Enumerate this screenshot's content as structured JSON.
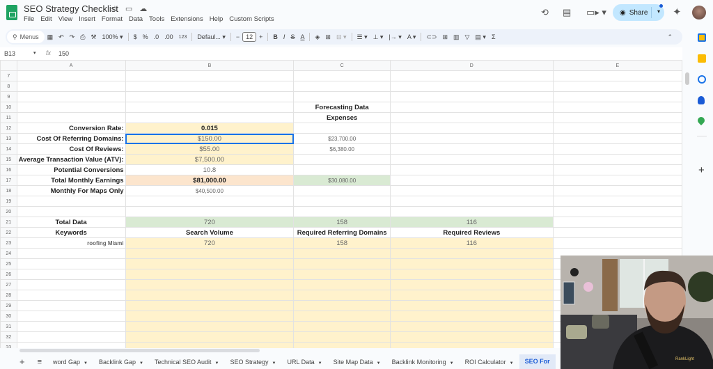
{
  "app": {
    "doc_title": "SEO Strategy Checklist",
    "menu": [
      "File",
      "Edit",
      "View",
      "Insert",
      "Format",
      "Data",
      "Tools",
      "Extensions",
      "Help",
      "Custom Scripts"
    ],
    "share_label": "Share"
  },
  "toolbar": {
    "menus_label": "Menus",
    "zoom": "100%",
    "currency": "$",
    "percent": "%",
    "dec_decrease": ".0",
    "dec_increase": ".00",
    "number_format": "123",
    "font": "Defaul...",
    "font_size": "12",
    "minus": "−",
    "plus": "+",
    "bold": "B",
    "italic": "I",
    "strike": "S",
    "sigma": "Σ"
  },
  "formula_bar": {
    "cell_ref": "B13",
    "fx": "fx",
    "value": "150"
  },
  "sheet": {
    "columns": [
      "A",
      "B",
      "C",
      "D",
      "E"
    ],
    "selected_column": "B",
    "rows": [
      {
        "n": "7",
        "a": "",
        "b": "",
        "c": "",
        "d": ""
      },
      {
        "n": "8",
        "a": "",
        "b": "",
        "c": "",
        "d": ""
      },
      {
        "n": "9",
        "a": "",
        "b": "",
        "c": "",
        "d": ""
      },
      {
        "n": "10",
        "a": "",
        "b": "",
        "c": "Forecasting Data",
        "d": ""
      },
      {
        "n": "11",
        "a": "",
        "b": "",
        "c": "Expenses",
        "d": ""
      },
      {
        "n": "12",
        "a": "Conversion Rate:",
        "b": "0.015",
        "c": "",
        "d": ""
      },
      {
        "n": "13",
        "a": "Cost Of Referring Domains:",
        "b": "$150.00",
        "c": "$23,700.00",
        "d": ""
      },
      {
        "n": "14",
        "a": "Cost Of Reviews:",
        "b": "$55.00",
        "c": "$6,380.00",
        "d": ""
      },
      {
        "n": "15",
        "a": "Average Transaction Value (ATV):",
        "b": "$7,500.00",
        "c": "",
        "d": ""
      },
      {
        "n": "16",
        "a": "Potential Conversions",
        "b": "10.8",
        "c": "",
        "d": ""
      },
      {
        "n": "17",
        "a": "Total Monthly Earnings",
        "b": "$81,000.00",
        "c": "$30,080.00",
        "d": ""
      },
      {
        "n": "18",
        "a": "Monthly For Maps Only",
        "b": "$40,500.00",
        "c": "",
        "d": ""
      },
      {
        "n": "19",
        "a": "",
        "b": "",
        "c": "",
        "d": ""
      },
      {
        "n": "20",
        "a": "",
        "b": "",
        "c": "",
        "d": ""
      },
      {
        "n": "21",
        "a": "Total Data",
        "b": "720",
        "c": "158",
        "d": "116"
      },
      {
        "n": "22",
        "a": "Keywords",
        "b": "Search Volume",
        "c": "Required Referring Domains",
        "d": "Required Reviews"
      },
      {
        "n": "23",
        "a": "roofing Miami",
        "b": "720",
        "c": "158",
        "d": "116"
      },
      {
        "n": "24",
        "a": "",
        "b": "",
        "c": "",
        "d": ""
      },
      {
        "n": "25",
        "a": "",
        "b": "",
        "c": "",
        "d": ""
      },
      {
        "n": "26",
        "a": "",
        "b": "",
        "c": "",
        "d": ""
      },
      {
        "n": "27",
        "a": "",
        "b": "",
        "c": "",
        "d": ""
      },
      {
        "n": "28",
        "a": "",
        "b": "",
        "c": "",
        "d": ""
      },
      {
        "n": "29",
        "a": "",
        "b": "",
        "c": "",
        "d": ""
      },
      {
        "n": "30",
        "a": "",
        "b": "",
        "c": "",
        "d": ""
      },
      {
        "n": "31",
        "a": "",
        "b": "",
        "c": "",
        "d": ""
      },
      {
        "n": "32",
        "a": "",
        "b": "",
        "c": "",
        "d": ""
      },
      {
        "n": "33",
        "a": "",
        "b": "",
        "c": "",
        "d": ""
      },
      {
        "n": "34",
        "a": "",
        "b": "",
        "c": "",
        "d": ""
      },
      {
        "n": "35",
        "a": "",
        "b": "",
        "c": "",
        "d": ""
      }
    ]
  },
  "colors": {
    "yellow_fill": "#fff2cc",
    "peach_fill": "#fce5cd",
    "green_fill": "#d9ead3",
    "selection": "#1a73e8",
    "share_bg": "#c2e7ff",
    "logo_green": "#1ea362"
  },
  "sheet_tabs": [
    {
      "label": "word Gap",
      "active": false
    },
    {
      "label": "Backlink Gap",
      "active": false
    },
    {
      "label": "Technical SEO Audit",
      "active": false
    },
    {
      "label": "SEO Strategy",
      "active": false
    },
    {
      "label": "URL Data",
      "active": false
    },
    {
      "label": "Site Map Data",
      "active": false
    },
    {
      "label": "Backlink Monitoring",
      "active": false
    },
    {
      "label": "ROI Calculator",
      "active": false
    },
    {
      "label": "SEO For",
      "active": true
    }
  ],
  "webcam": {
    "shirt_text": "RankLight"
  }
}
